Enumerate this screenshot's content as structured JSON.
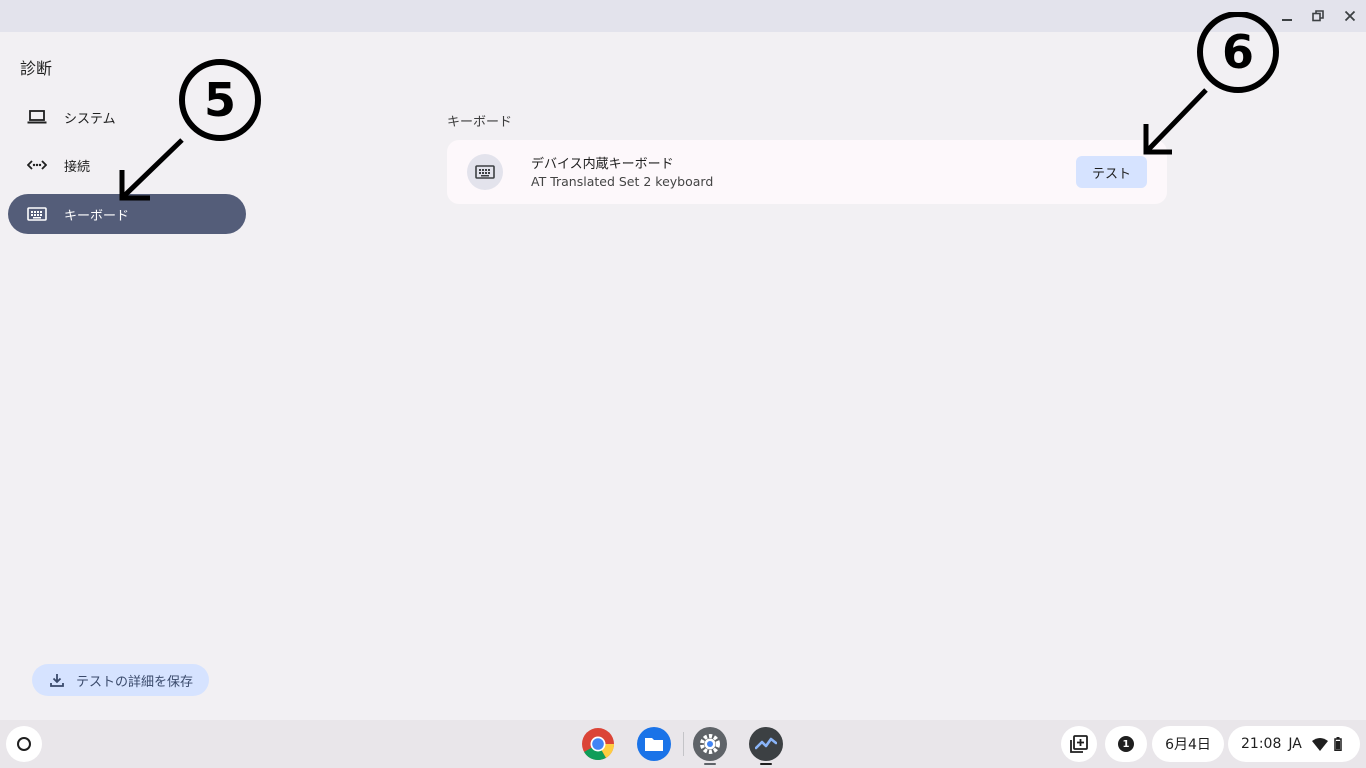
{
  "app": {
    "title": "診断"
  },
  "sidebar": {
    "items": [
      {
        "label": "システム",
        "icon": "laptop-icon"
      },
      {
        "label": "接続",
        "icon": "connectivity-icon"
      },
      {
        "label": "キーボード",
        "icon": "keyboard-icon",
        "selected": true
      }
    ],
    "save_label": "テストの詳細を保存"
  },
  "main": {
    "section_title": "キーボード",
    "keyboard": {
      "name": "デバイス内蔵キーボード",
      "detail": "AT Translated Set 2 keyboard",
      "test_label": "テスト"
    }
  },
  "annotations": [
    {
      "label": "5"
    },
    {
      "label": "6"
    }
  ],
  "shelf": {
    "apps": [
      "chrome-icon",
      "files-icon",
      "settings-icon",
      "diagnostics-icon"
    ],
    "notification_count": "1",
    "date": "6月4日",
    "time": "21:08",
    "ime": "JA"
  },
  "colors": {
    "accent": "#545d79",
    "button": "#d6e3ff",
    "background": "#f2f0f3"
  }
}
